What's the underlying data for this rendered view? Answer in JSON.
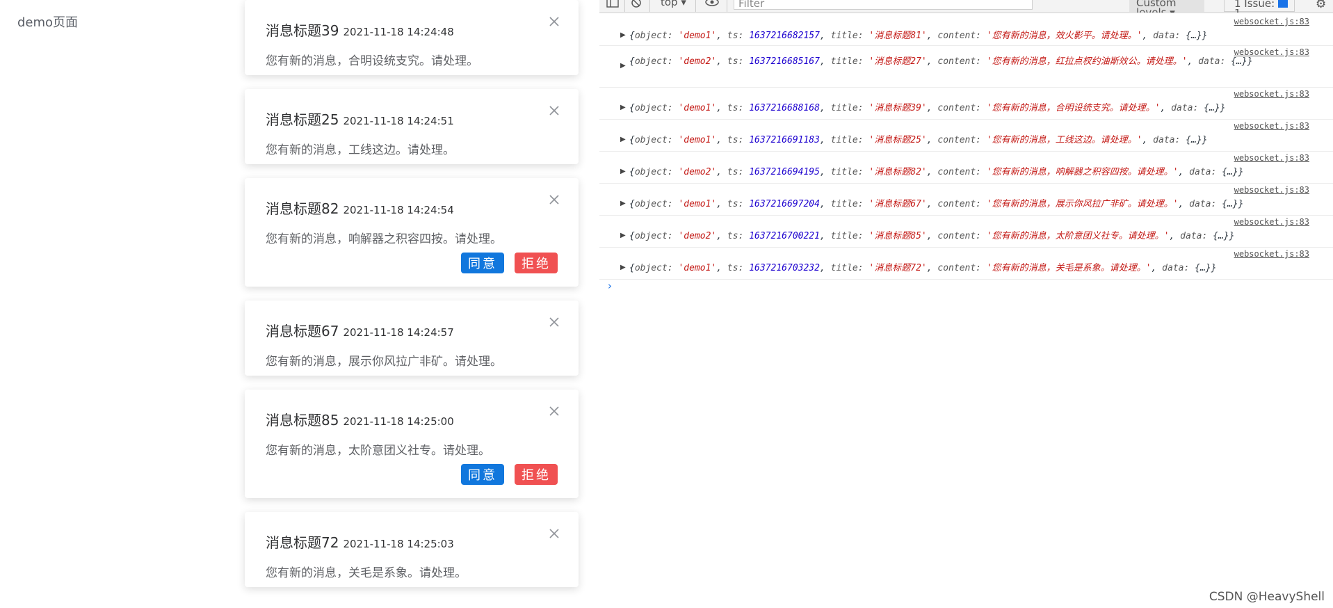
{
  "page": {
    "title": "demo页面"
  },
  "notifications": [
    {
      "title": "消息标题39",
      "time": "2021-11-18 14:24:48",
      "content": "您有新的消息，合明设统支究。请处理。",
      "has_actions": false
    },
    {
      "title": "消息标题25",
      "time": "2021-11-18 14:24:51",
      "content": "您有新的消息，工线这边。请处理。",
      "has_actions": false
    },
    {
      "title": "消息标题82",
      "time": "2021-11-18 14:24:54",
      "content": "您有新的消息，响解器之积容四按。请处理。",
      "has_actions": true,
      "agree_label": "同意",
      "reject_label": "拒绝"
    },
    {
      "title": "消息标题67",
      "time": "2021-11-18 14:24:57",
      "content": "您有新的消息，展示你风拉广非矿。请处理。",
      "has_actions": false
    },
    {
      "title": "消息标题85",
      "time": "2021-11-18 14:25:00",
      "content": "您有新的消息，太阶意团义社专。请处理。",
      "has_actions": true,
      "agree_label": "同意",
      "reject_label": "拒绝"
    },
    {
      "title": "消息标题72",
      "time": "2021-11-18 14:25:03",
      "content": "您有新的消息，关毛是系象。请处理。",
      "has_actions": false
    }
  ],
  "devtools": {
    "context": "top",
    "filter_placeholder": "Filter",
    "levels_label": "Custom levels",
    "issues_label": "1 Issue:",
    "issues_count": "1",
    "logs": [
      {
        "source": "websocket.js:83",
        "object": "demo1",
        "ts": "1637216682157",
        "title": "消息标题81",
        "content": "您有新的消息，效火影平。请处理。"
      },
      {
        "source": "websocket.js:83",
        "object": "demo2",
        "ts": "1637216685167",
        "title": "消息标题27",
        "content": "您有新的消息，红拉点杈约油斯效公。请处理。"
      },
      {
        "source": "websocket.js:83",
        "object": "demo1",
        "ts": "1637216688168",
        "title": "消息标题39",
        "content": "您有新的消息，合明设统支究。请处理。"
      },
      {
        "source": "websocket.js:83",
        "object": "demo1",
        "ts": "1637216691183",
        "title": "消息标题25",
        "content": "您有新的消息，工线这边。请处理。"
      },
      {
        "source": "websocket.js:83",
        "object": "demo2",
        "ts": "1637216694195",
        "title": "消息标题82",
        "content": "您有新的消息，响解器之积容四按。请处理。"
      },
      {
        "source": "websocket.js:83",
        "object": "demo1",
        "ts": "1637216697204",
        "title": "消息标题67",
        "content": "您有新的消息，展示你风拉广非矿。请处理。"
      },
      {
        "source": "websocket.js:83",
        "object": "demo2",
        "ts": "1637216700221",
        "title": "消息标题85",
        "content": "您有新的消息，太阶意团义社专。请处理。"
      },
      {
        "source": "websocket.js:83",
        "object": "demo1",
        "ts": "1637216703232",
        "title": "消息标题72",
        "content": "您有新的消息，关毛是系象。请处理。"
      }
    ],
    "prompt": "›"
  },
  "watermark": "CSDN @HeavyShell"
}
